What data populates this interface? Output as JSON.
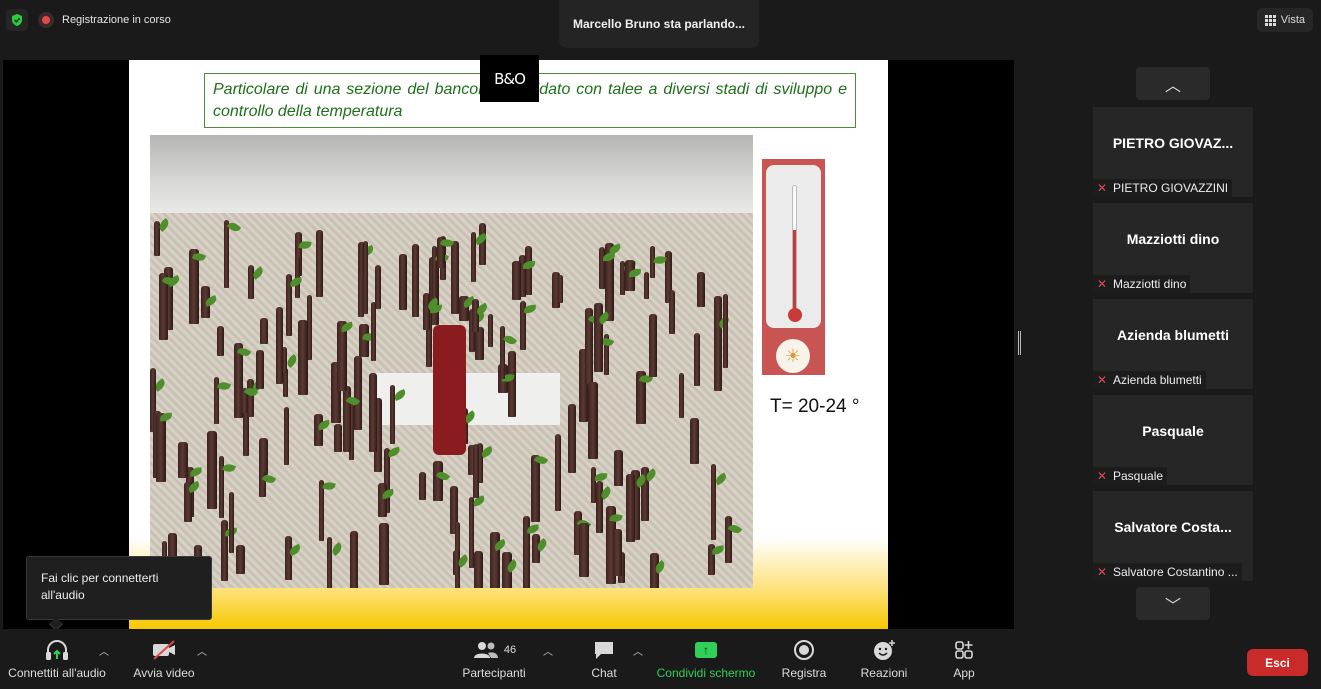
{
  "top": {
    "recording_label": "Registrazione in corso",
    "speaking_label": "Marcello Bruno sta parlando...",
    "view_label": "Vista"
  },
  "slide": {
    "logo_text": "B&O",
    "caption": "Particolare di una sezione del bancone riscaldato con talee a diversi stadi di sviluppo e controllo della temperatura",
    "temperature_text": "T= 20-24 °"
  },
  "participants": [
    {
      "tile_name": "PIETRO  GIOVAZ...",
      "label": "PIETRO GIOVAZZINI"
    },
    {
      "tile_name": "Mazziotti dino",
      "label": "Mazziotti dino"
    },
    {
      "tile_name": "Azienda blumetti",
      "label": "Azienda blumetti"
    },
    {
      "tile_name": "Pasquale",
      "label": "Pasquale"
    },
    {
      "tile_name": "Salvatore  Costa...",
      "label": "Salvatore Costantino ..."
    }
  ],
  "tooltip": {
    "text": "Fai clic per connetterti all'audio"
  },
  "toolbar": {
    "audio_label": "Connettiti all'audio",
    "video_label": "Avvia video",
    "participants_label": "Partecipanti",
    "participants_count": "46",
    "chat_label": "Chat",
    "share_label": "Condividi schermo",
    "record_label": "Registra",
    "reactions_label": "Reazioni",
    "apps_label": "App",
    "leave_label": "Esci"
  },
  "colors": {
    "share_green": "#2fcf5a",
    "leave_red": "#c92a2a",
    "caption_green": "#1f6f1a"
  }
}
